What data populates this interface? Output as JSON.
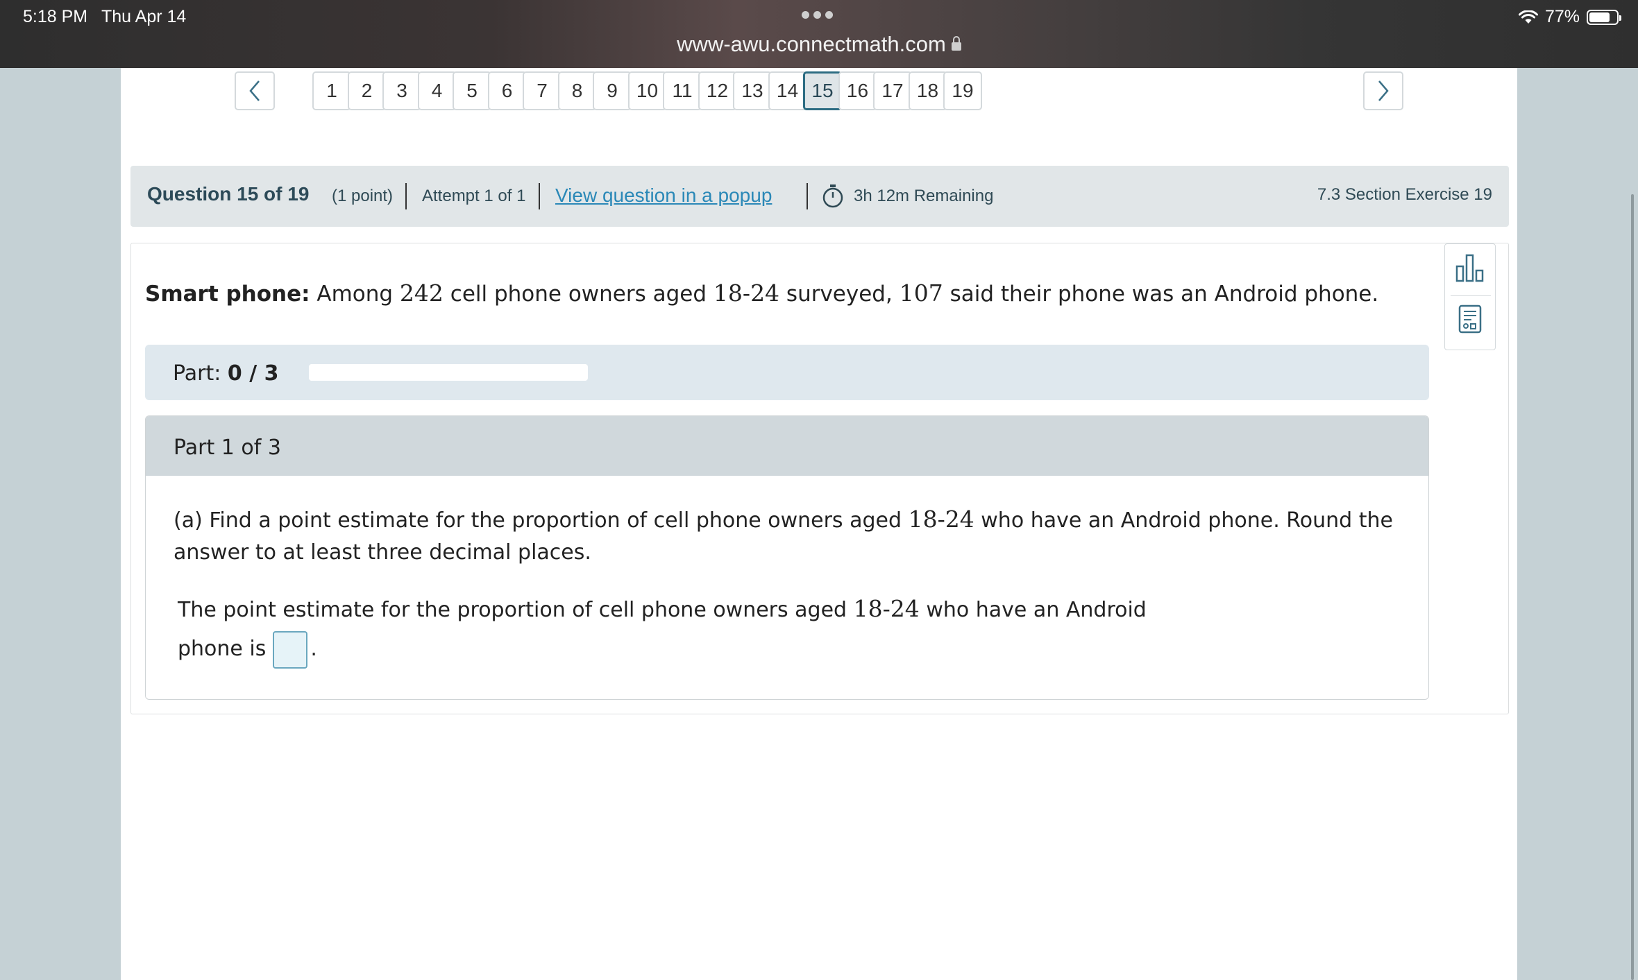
{
  "status_bar": {
    "time": "5:18 PM",
    "date": "Thu Apr 14",
    "url": "www-awu.connectmath.com",
    "battery": "77%"
  },
  "pager": {
    "pages": [
      "1",
      "2",
      "3",
      "4",
      "5",
      "6",
      "7",
      "8",
      "9",
      "10",
      "11",
      "12",
      "13",
      "14",
      "15",
      "16",
      "17",
      "18",
      "19"
    ],
    "active": "15",
    "prev_icon": "chevron-left-icon",
    "next_icon": "chevron-right-icon"
  },
  "question_header": {
    "title": "Question 15 of 19",
    "points": "(1 point)",
    "attempt": "Attempt 1 of 1",
    "popup_link": "View question in a popup",
    "timer_icon": "stopwatch-icon",
    "remaining": "3h 12m Remaining",
    "section": "7.3 Section Exercise 19"
  },
  "problem": {
    "label": "Smart phone:",
    "text_1": "Among",
    "n_total": "242",
    "text_2": "cell phone owners aged",
    "age": "18-24",
    "text_3": "surveyed,",
    "n_android": "107",
    "text_4": "said their phone was an Android phone."
  },
  "tools": [
    "bar-chart-icon",
    "calculator-icon"
  ],
  "progress": {
    "label": "Part:",
    "value": "0 / 3",
    "fraction": 0
  },
  "part": {
    "header": "Part 1 of 3",
    "q_1": "(a) Find a point estimate for the proportion of cell phone owners aged",
    "q_age": "18-24",
    "q_2": "who have an Android phone. Round the answer to at least three decimal places.",
    "a_1": "The point estimate for the proportion of cell phone owners aged",
    "a_age": "18-24",
    "a_2": "who have an Android",
    "a_3": "phone is",
    "a_end": ".",
    "answer_value": ""
  },
  "colors": {
    "accent": "#2c6c82",
    "link": "#2a88b7",
    "header_bg": "#e1e6e8",
    "progress_bg": "#dfe8ee",
    "part_header_bg": "#d0d8dc"
  }
}
